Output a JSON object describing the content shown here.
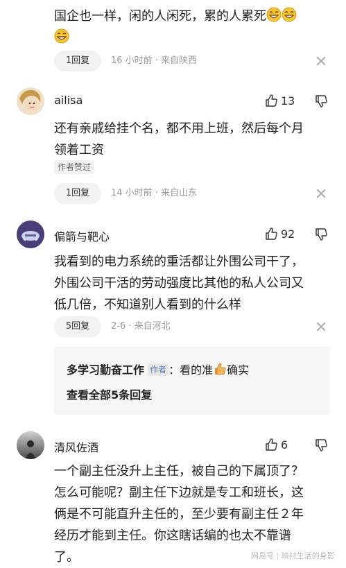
{
  "comments": [
    {
      "text_line1": "国企也一样，闲的人闲死，累的人累死",
      "reply_label": "1回复",
      "meta": "16 小时前 · 来自陕西"
    },
    {
      "username": "ailisa",
      "likes": "13",
      "text_line1": "还有亲戚给挂个名，都不用上班，然后每个月",
      "text_line2": "领着工资",
      "author_liked": "作者赞过",
      "reply_label": "1回复",
      "meta": "14 小时前 · 来自山东"
    },
    {
      "username": "偏箭与靶心",
      "likes": "92",
      "text_line1": "我看到的电力系统的重活都让外围公司干了，",
      "text_line2": "外围公司干活的劳动强度比其他的私人公司又",
      "text_line3": "低几倍，不知道别人看到的什么样",
      "reply_label": "5回复",
      "meta": "2-6 · 来自河北",
      "sub_reply": {
        "name": "多学习勤奋工作",
        "author_tag": "作者",
        "text_before": "：看的准",
        "text_after": "确实",
        "view_all": "查看全部5条回复"
      }
    },
    {
      "username": "清风佐酒",
      "likes": "6",
      "text_line1": "一个副主任没升上主任，被自己的下属顶了？",
      "text_line2": "怎么可能呢？副主任下边就是专工和班长，这",
      "text_line3": "俩是不可能直升主任的，至少要有副主任２年",
      "text_line4": "经历才能到主任。你这瞎话编的也太不靠谱",
      "text_line5": "了。"
    }
  ],
  "watermark": {
    "brand": "网易号",
    "account": "映衬生活的身影"
  },
  "colors": {
    "text": "#222222",
    "meta": "#999999",
    "pill_bg": "#f2f2f2",
    "reply_box_bg": "#f6f6f6"
  }
}
